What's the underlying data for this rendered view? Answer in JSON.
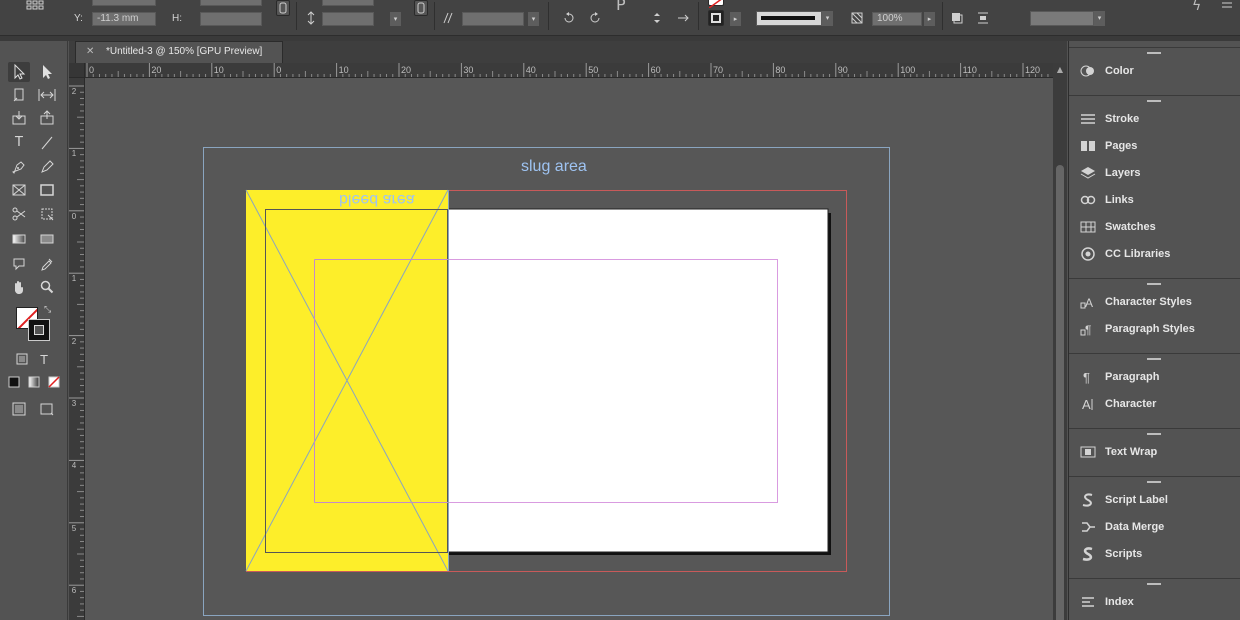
{
  "window": {
    "document_tab": "*Untitled-3 @ 150% [GPU Preview]"
  },
  "controlbar": {
    "y_label": "Y:",
    "y_value": "-11.3 mm",
    "h_label": "H:",
    "zoom_value": "100%"
  },
  "ruler": {
    "horizontal": [
      "0",
      "20",
      "10",
      "0",
      "10",
      "20",
      "30",
      "40",
      "50",
      "60",
      "70",
      "80",
      "90",
      "100",
      "110",
      "120"
    ],
    "vertical": [
      "2",
      "1",
      "0",
      "1",
      "2",
      "3",
      "4",
      "5",
      "6"
    ]
  },
  "canvas": {
    "slug_label": "slug area",
    "bleed_label": "bleed area",
    "colors": {
      "pasteboard": "#575757",
      "page": "#ffffff",
      "yellow_frame": "#fdee2a",
      "slug_guide": "#8aa5c0",
      "bleed_guide": "#d25c5c",
      "margin_guide": "#d99be0"
    }
  },
  "panels": [
    {
      "icon": "color-icon",
      "label": "Color"
    },
    {
      "icon": "stroke-icon",
      "label": "Stroke"
    },
    {
      "icon": "pages-icon",
      "label": "Pages"
    },
    {
      "icon": "layers-icon",
      "label": "Layers"
    },
    {
      "icon": "links-icon",
      "label": "Links"
    },
    {
      "icon": "swatches-icon",
      "label": "Swatches"
    },
    {
      "icon": "cc-libraries-icon",
      "label": "CC Libraries"
    },
    {
      "icon": "character-styles-icon",
      "label": "Character Styles"
    },
    {
      "icon": "paragraph-styles-icon",
      "label": "Paragraph Styles"
    },
    {
      "icon": "paragraph-icon",
      "label": "Paragraph"
    },
    {
      "icon": "character-icon",
      "label": "Character"
    },
    {
      "icon": "text-wrap-icon",
      "label": "Text Wrap"
    },
    {
      "icon": "script-label-icon",
      "label": "Script Label"
    },
    {
      "icon": "data-merge-icon",
      "label": "Data Merge"
    },
    {
      "icon": "scripts-icon",
      "label": "Scripts"
    },
    {
      "icon": "index-icon",
      "label": "Index"
    }
  ],
  "tools": {
    "type_tool_glyph": "T",
    "formatting_text_glyph": "T"
  }
}
